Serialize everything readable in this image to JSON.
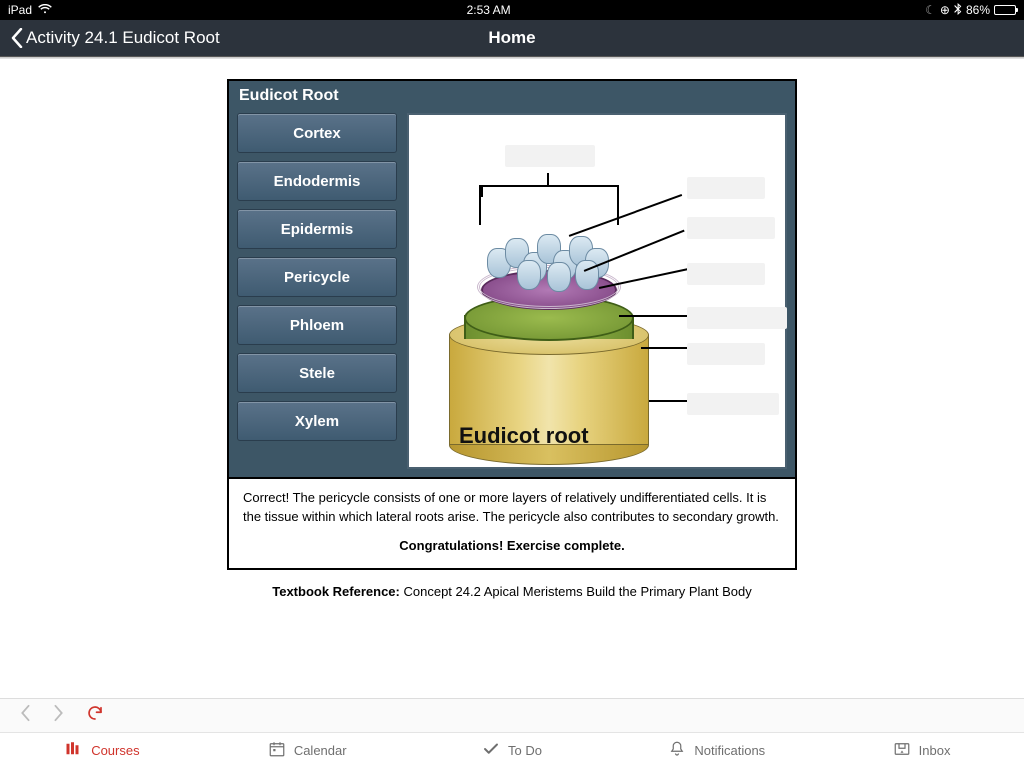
{
  "status": {
    "device": "iPad",
    "time": "2:53 AM",
    "battery_pct": "86%"
  },
  "nav": {
    "back_label": "Activity 24.1 Eudicot Root",
    "title": "Home"
  },
  "activity": {
    "title": "Eudicot Root",
    "terms": [
      "Cortex",
      "Endodermis",
      "Epidermis",
      "Pericycle",
      "Phloem",
      "Stele",
      "Xylem"
    ],
    "diagram_caption": "Eudicot root"
  },
  "feedback": {
    "text": "Correct! The pericycle consists of one or more layers of relatively undifferentiated cells. It is the tissue within which lateral roots arise. The pericycle also contributes to secondary growth.",
    "congrats": "Congratulations! Exercise complete."
  },
  "reference": {
    "label": "Textbook Reference:",
    "text": " Concept 24.2 Apical Meristems Build the Primary Plant Body"
  },
  "tabs": {
    "courses": "Courses",
    "calendar": "Calendar",
    "todo": "To Do",
    "notifications": "Notifications",
    "inbox": "Inbox"
  }
}
